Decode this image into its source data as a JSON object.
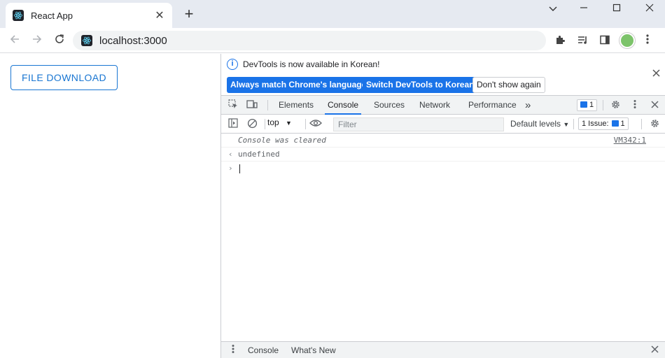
{
  "browser": {
    "tab_title": "React App",
    "tab_close": "✕",
    "new_tab": "+",
    "url": "localhost:3000"
  },
  "page": {
    "file_download_label": "FILE DOWNLOAD",
    "accent_color": "#1976d2"
  },
  "devtools": {
    "infobar": {
      "message": "DevTools is now available in Korean!",
      "match_language_label": "Always match Chrome's language",
      "switch_korean_label": "Switch DevTools to Korean",
      "dont_show_label": "Don't show again"
    },
    "tabs": [
      {
        "label": "Elements"
      },
      {
        "label": "Console"
      },
      {
        "label": "Sources"
      },
      {
        "label": "Network"
      },
      {
        "label": "Performance"
      }
    ],
    "more_tabs": "»",
    "message_count": "1",
    "console_toolbar": {
      "context": "top",
      "filter_placeholder": "Filter",
      "levels": "Default levels",
      "issues_label": "1 Issue:",
      "issues_count": "1"
    },
    "console": {
      "cleared_text": "Console was cleared",
      "cleared_source": "VM342:1",
      "result_text": "undefined"
    },
    "drawer": {
      "tabs": [
        {
          "label": "Console"
        },
        {
          "label": "What's New"
        }
      ]
    }
  }
}
